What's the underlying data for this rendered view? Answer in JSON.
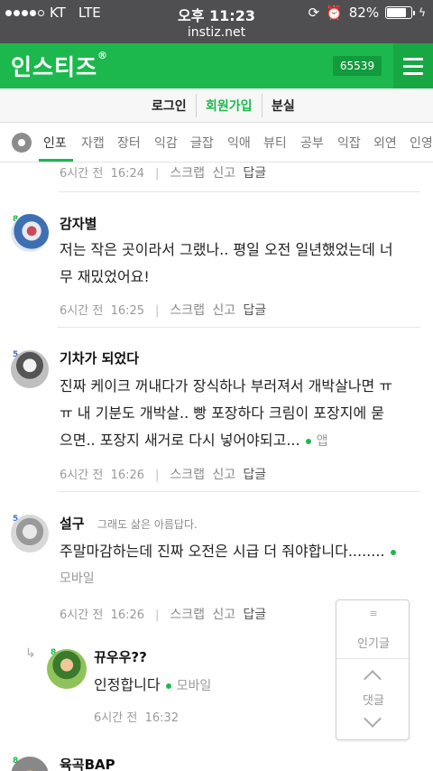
{
  "status_bar": {
    "carrier": "KT",
    "network": "LTE",
    "time": "오후 11:23",
    "battery": "82%",
    "battery_level": 0.82
  },
  "url": "instiz.net",
  "header": {
    "logo": "인스티즈",
    "logo_mark": "®",
    "count": "65539",
    "brand_color": "#1cb84d"
  },
  "auth": {
    "login": "로그인",
    "signup": "회원가입",
    "bunsil": "분실"
  },
  "categories": [
    "인포",
    "자캡",
    "장터",
    "익감",
    "글잡",
    "익애",
    "뷰티",
    "공부",
    "익잡",
    "외연",
    "인영"
  ],
  "comments": [
    {
      "time": "6시간 전",
      "clock": "16:24",
      "actions": [
        "스크랩",
        "신고"
      ],
      "reply": "답글"
    },
    {
      "level": "8",
      "nick": "감자별",
      "lines": [
        "저는 작은 곳이라서 그랬나.. 평일 오전 일년했었는데 너",
        "무 재밌었어요!"
      ],
      "time": "6시간 전",
      "clock": "16:25",
      "actions": [
        "스크랩",
        "신고"
      ],
      "reply": "답글"
    },
    {
      "level": "5",
      "nick": "기차가 되었다",
      "lines": [
        "진짜 케이크 꺼내다가 장식하나 부러져서 개박살나면 ㅠ",
        "ㅠ 내 기분도 개박살.. 빵 포장하다 크림이 포장지에 묻",
        "으면.. 포장지 새거로 다시 넣어야되고..."
      ],
      "via": "앱",
      "time": "6시간 전",
      "clock": "16:26",
      "actions": [
        "스크랩",
        "신고"
      ],
      "reply": "답글"
    },
    {
      "level": "5",
      "nick": "설구",
      "note": "그래도 삶은 아름답다.",
      "lines": [
        "주말마감하는데 진짜 오전은 시급 더 줘야합니다........"
      ],
      "via": "모바일",
      "time": "6시간 전",
      "clock": "16:26",
      "actions": [
        "스크랩",
        "신고"
      ],
      "reply": "답글"
    }
  ],
  "reply_comment": {
    "level": "8",
    "nick": "뀨우우??",
    "text": "인정합니다",
    "via": "모바일",
    "time": "6시간 전",
    "clock": "16:32"
  },
  "next_comment": {
    "level": "8",
    "nick": "육곡BAP"
  },
  "float_panel": {
    "icon": "≡",
    "popular": "인기글",
    "comments": "댓글"
  }
}
